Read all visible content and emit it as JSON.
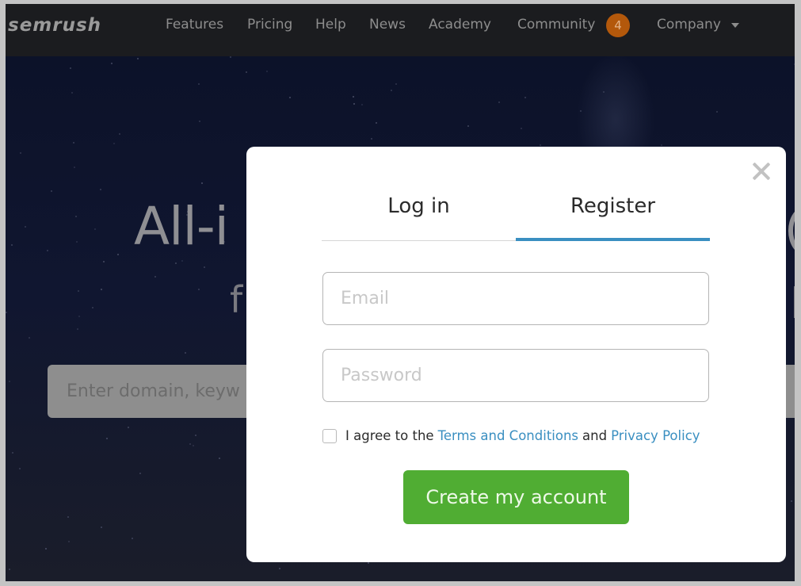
{
  "navbar": {
    "logo": "semrush",
    "items": [
      {
        "label": "Features"
      },
      {
        "label": "Pricing"
      },
      {
        "label": "Help"
      },
      {
        "label": "News"
      },
      {
        "label": "Academy"
      },
      {
        "label": "Community",
        "badge": "4"
      },
      {
        "label": "Company",
        "has_dropdown": true
      }
    ],
    "colors": {
      "badge": "#b3580b",
      "background": "#1b1c1f"
    }
  },
  "hero": {
    "title_visible": "All-i",
    "subtitle_visible": "f",
    "search_placeholder_visible": "Enter domain, keyw"
  },
  "modal": {
    "close_icon": "close-icon",
    "tabs": [
      {
        "label": "Log in",
        "active": false
      },
      {
        "label": "Register",
        "active": true
      }
    ],
    "email_placeholder": "Email",
    "password_placeholder": "Password",
    "agree": {
      "prefix": "I agree to the",
      "terms_link": "Terms and Conditions",
      "middle": "and",
      "privacy_link": "Privacy Policy",
      "checked": false
    },
    "submit_label": "Create my account",
    "colors": {
      "accent": "#3a8fc1",
      "submit": "#50ad33"
    }
  }
}
